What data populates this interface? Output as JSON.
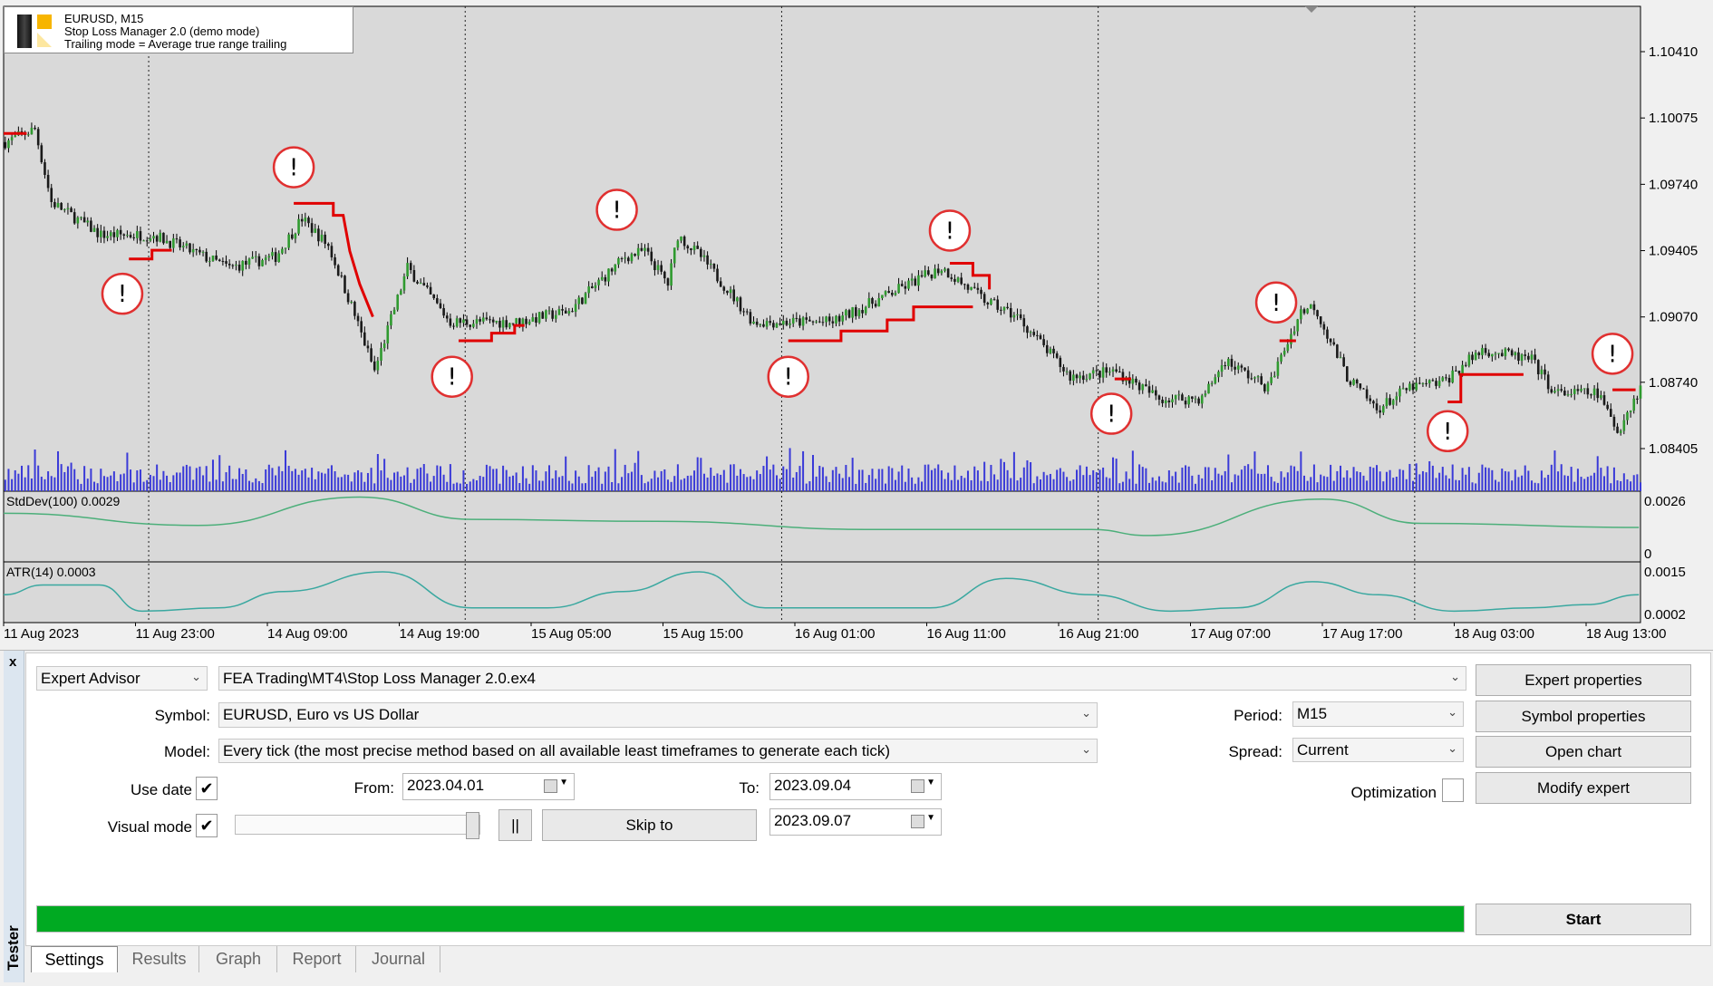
{
  "legend": {
    "line1": "EURUSD, M15",
    "line2": "Stop Loss Manager 2.0 (demo mode)",
    "line3": "Trailing mode = Average true range trailing"
  },
  "chart_data": {
    "type": "candlestick",
    "symbol": "EURUSD",
    "timeframe": "M15",
    "price_axis": {
      "ticks": [
        "1.10410",
        "1.10075",
        "1.09740",
        "1.09405",
        "1.09070",
        "1.08740",
        "1.08405"
      ],
      "range": [
        1.08405,
        1.1041
      ]
    },
    "time_axis": {
      "ticks": [
        "11 Aug 2023",
        "11 Aug 23:00",
        "14 Aug 09:00",
        "14 Aug 19:00",
        "15 Aug 05:00",
        "15 Aug 15:00",
        "16 Aug 01:00",
        "16 Aug 11:00",
        "16 Aug 21:00",
        "17 Aug 07:00",
        "17 Aug 17:00",
        "18 Aug 03:00",
        "18 Aug 13:00"
      ]
    },
    "price_path": [
      [
        "08-11 13:00",
        1.09953
      ],
      [
        "08-11 15:15",
        1.10019
      ],
      [
        "08-11 16:30",
        1.0965
      ],
      [
        "08-11 20:15",
        1.09484
      ],
      [
        "08-14 00:15",
        1.09484
      ],
      [
        "08-14 06:00",
        1.09319
      ],
      [
        "08-14 09:30",
        1.09374
      ],
      [
        "08-14 11:30",
        1.09567
      ],
      [
        "08-14 13:30",
        1.09429
      ],
      [
        "08-14 15:15",
        1.09126
      ],
      [
        "08-14 17:00",
        1.08796
      ],
      [
        "08-14 19:30",
        1.09319
      ],
      [
        "08-14 22:45",
        1.09044
      ],
      [
        "08-15 03:45",
        1.09044
      ],
      [
        "08-15 07:45",
        1.09099
      ],
      [
        "08-15 12:00",
        1.09374
      ],
      [
        "08-15 13:30",
        1.09402
      ],
      [
        "08-15 15:15",
        1.09236
      ],
      [
        "08-15 16:00",
        1.09484
      ],
      [
        "08-15 17:45",
        1.09374
      ],
      [
        "08-15 21:45",
        1.09044
      ],
      [
        "08-16 03:45",
        1.09044
      ],
      [
        "08-16 08:45",
        1.09209
      ],
      [
        "08-16 12:00",
        1.09319
      ],
      [
        "08-16 15:15",
        1.09154
      ],
      [
        "08-16 17:45",
        1.09071
      ],
      [
        "08-16 21:45",
        1.08768
      ],
      [
        "08-17 01:15",
        1.08796
      ],
      [
        "08-17 04:30",
        1.08658
      ],
      [
        "08-17 07:45",
        1.08658
      ],
      [
        "08-17 09:30",
        1.08851
      ],
      [
        "08-17 12:45",
        1.08713
      ],
      [
        "08-17 15:15",
        1.09099
      ],
      [
        "08-17 16:15",
        1.09126
      ],
      [
        "08-17 18:45",
        1.08768
      ],
      [
        "08-17 21:00",
        1.08603
      ],
      [
        "08-17 23:30",
        1.08713
      ],
      [
        "08-18 02:00",
        1.0874
      ],
      [
        "08-18 05:00",
        1.08906
      ],
      [
        "08-18 08:45",
        1.08851
      ],
      [
        "08-18 10:30",
        1.08685
      ],
      [
        "08-18 13:45",
        1.08685
      ],
      [
        "08-18 15:15",
        1.08493
      ],
      [
        "08-18 17:00",
        1.08713
      ]
    ],
    "stop_loss_lines": [
      [
        [
          "08-11 13:00",
          1.09997
        ],
        [
          "08-11 14:45",
          1.09997
        ]
      ],
      [
        [
          "08-11 22:30",
          1.09363
        ],
        [
          "08-14 00:15",
          1.09363
        ],
        [
          "08-14 00:15",
          1.09407
        ],
        [
          "08-14 01:45",
          1.09407
        ]
      ],
      [
        [
          "08-14 11:00",
          1.09644
        ],
        [
          "08-14 14:00",
          1.09644
        ],
        [
          "08-14 14:00",
          1.09583
        ],
        [
          "08-14 14:45",
          1.09583
        ],
        [
          "08-14 15:15",
          1.09402
        ],
        [
          "08-14 16:00",
          1.09236
        ],
        [
          "08-14 17:00",
          1.09071
        ]
      ],
      [
        [
          "08-14 23:30",
          1.0895
        ],
        [
          "08-15 02:00",
          1.0895
        ],
        [
          "08-15 02:00",
          1.08988
        ],
        [
          "08-15 03:45",
          1.08988
        ],
        [
          "08-15 03:45",
          1.09027
        ],
        [
          "08-15 04:30",
          1.09027
        ]
      ],
      [
        [
          "08-16 00:30",
          1.0895
        ],
        [
          "08-16 04:30",
          1.0895
        ],
        [
          "08-16 04:30",
          1.08999
        ],
        [
          "08-16 08:00",
          1.08999
        ],
        [
          "08-16 08:00",
          1.09055
        ],
        [
          "08-16 10:00",
          1.09055
        ],
        [
          "08-16 10:00",
          1.09121
        ],
        [
          "08-16 14:30",
          1.09121
        ]
      ],
      [
        [
          "08-16 12:45",
          1.09341
        ],
        [
          "08-16 14:30",
          1.09341
        ],
        [
          "08-16 14:30",
          1.0928
        ],
        [
          "08-16 15:45",
          1.0928
        ],
        [
          "08-16 15:45",
          1.09209
        ]
      ],
      [
        [
          "08-17 01:15",
          1.08757
        ],
        [
          "08-17 02:30",
          1.08757
        ]
      ],
      [
        [
          "08-17 13:45",
          1.0895
        ],
        [
          "08-17 15:00",
          1.0895
        ]
      ],
      [
        [
          "08-18 02:30",
          1.08641
        ],
        [
          "08-18 03:30",
          1.08641
        ],
        [
          "08-18 03:30",
          1.08779
        ],
        [
          "08-18 08:15",
          1.08779
        ]
      ],
      [
        [
          "08-18 15:00",
          1.08702
        ],
        [
          "08-18 16:45",
          1.08702
        ]
      ]
    ],
    "warning_markers": [
      [
        "08-11 22:00",
        1.09187
      ],
      [
        "08-14 11:00",
        1.09826
      ],
      [
        "08-14 23:00",
        1.08768
      ],
      [
        "08-15 11:30",
        1.09611
      ],
      [
        "08-16 00:30",
        1.08768
      ],
      [
        "08-16 12:45",
        1.09506
      ],
      [
        "08-17 01:00",
        1.08581
      ],
      [
        "08-17 13:30",
        1.09143
      ],
      [
        "08-18 02:30",
        1.08493
      ],
      [
        "08-18 15:00",
        1.08884
      ]
    ],
    "marker_symbol": "!",
    "indicators": [
      {
        "label": "StdDev(100) 0.0029",
        "ticks": [
          "0.0026",
          "0"
        ],
        "range": [
          0,
          0.0026
        ],
        "color": "#4caf7a",
        "values": [
          [
            "08-11 13:00",
            0.002
          ],
          [
            "08-14 03:45",
            0.0014
          ],
          [
            "08-14 16:00",
            0.0028
          ],
          [
            "08-15 00:30",
            0.0017
          ],
          [
            "08-15 14:30",
            0.0016
          ],
          [
            "08-16 07:00",
            0.0012
          ],
          [
            "08-16 23:30",
            0.0012
          ],
          [
            "08-17 03:45",
            0.0009
          ],
          [
            "08-17 17:00",
            0.0027
          ],
          [
            "08-18 00:30",
            0.0015
          ],
          [
            "08-18 17:00",
            0.0013
          ]
        ]
      },
      {
        "label": "ATR(14) 0.0003",
        "ticks": [
          "0.0015",
          "0.0002"
        ],
        "range": [
          0.0002,
          0.0015
        ],
        "color": "#3aa8a0",
        "values": [
          [
            "08-11 13:00",
            0.0008
          ],
          [
            "08-11 16:00",
            0.0011
          ],
          [
            "08-11 20:15",
            0.0011
          ],
          [
            "08-11 23:30",
            0.0003
          ],
          [
            "08-14 05:15",
            0.0004
          ],
          [
            "08-14 10:15",
            0.0009
          ],
          [
            "08-14 17:45",
            0.0015
          ],
          [
            "08-15 00:30",
            0.0004
          ],
          [
            "08-15 06:15",
            0.0004
          ],
          [
            "08-15 12:00",
            0.0009
          ],
          [
            "08-15 17:45",
            0.0015
          ],
          [
            "08-15 22:45",
            0.0004
          ],
          [
            "08-16 07:00",
            0.0004
          ],
          [
            "08-16 11:15",
            0.0004
          ],
          [
            "08-16 17:00",
            0.0013
          ],
          [
            "08-16 23:30",
            0.0008
          ],
          [
            "08-17 05:30",
            0.0003
          ],
          [
            "08-17 10:30",
            0.0004
          ],
          [
            "08-17 16:15",
            0.0012
          ],
          [
            "08-17 21:15",
            0.0008
          ],
          [
            "08-18 03:00",
            0.0003
          ],
          [
            "08-18 08:45",
            0.0004
          ],
          [
            "08-18 13:00",
            0.0005
          ],
          [
            "08-18 17:00",
            0.0008
          ]
        ]
      }
    ],
    "colors": {
      "background": "#d9d9d9",
      "bull": "#2f9a2f",
      "bear": "#1a1a1a",
      "stop_loss": "#e00000",
      "volume": "#3a3ad8",
      "marker": "#e03030"
    }
  },
  "tester": {
    "close": "x",
    "side_label": "Tester",
    "type_select": "Expert Advisor",
    "ea_path": "FEA Trading\\MT4\\Stop Loss Manager 2.0.ex4",
    "symbol_label": "Symbol:",
    "symbol_value": "EURUSD, Euro vs US Dollar",
    "model_label": "Model:",
    "model_value": "Every tick (the most precise method based on all available least timeframes to generate each tick)",
    "period_label": "Period:",
    "period_value": "M15",
    "spread_label": "Spread:",
    "spread_value": "Current",
    "use_date_label": "Use date",
    "use_date_checked": true,
    "from_label": "From:",
    "from_value": "2023.04.01",
    "to_label": "To:",
    "to_value": "2023.09.04",
    "optimization_label": "Optimization",
    "optimization_checked": false,
    "visual_mode_label": "Visual mode",
    "visual_mode_checked": true,
    "speed_slider": 1.0,
    "pause_label": "||",
    "skip_to_label": "Skip to",
    "skip_to_value": "2023.09.07",
    "progress": 100,
    "progress_color": "#00aa22",
    "buttons": {
      "expert_properties": "Expert properties",
      "symbol_properties": "Symbol properties",
      "open_chart": "Open chart",
      "modify_expert": "Modify expert",
      "start": "Start"
    },
    "tabs": [
      {
        "label": "Settings",
        "active": true
      },
      {
        "label": "Results"
      },
      {
        "label": "Graph"
      },
      {
        "label": "Report"
      },
      {
        "label": "Journal"
      }
    ]
  }
}
